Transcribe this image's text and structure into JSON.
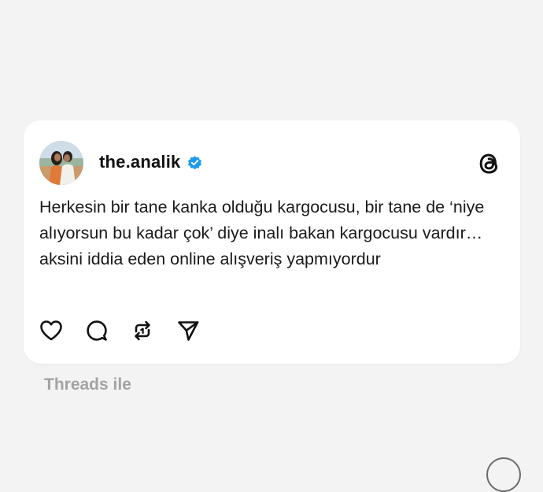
{
  "post": {
    "username": "the.analik",
    "verified": true,
    "text": "Herkesin bir tane kanka olduğu kargocusu, bir tane de ‘niye alıyorsun bu kadar çok’ diye inalı bakan kargocusu vardır… aksini iddia eden online alışveriş yapmıyordur",
    "icons": {
      "logo": "threads-logo-icon",
      "like": "heart-icon",
      "comment": "comment-icon",
      "repost": "repost-icon",
      "share": "send-icon",
      "verified": "verified-badge-icon"
    }
  },
  "footer": {
    "label": "Threads ile"
  },
  "colors": {
    "background": "#f3f3f3",
    "card": "#ffffff",
    "text": "#1a1a1a",
    "verified": "#1d9bf0",
    "footer_text": "#a3a3a3"
  }
}
